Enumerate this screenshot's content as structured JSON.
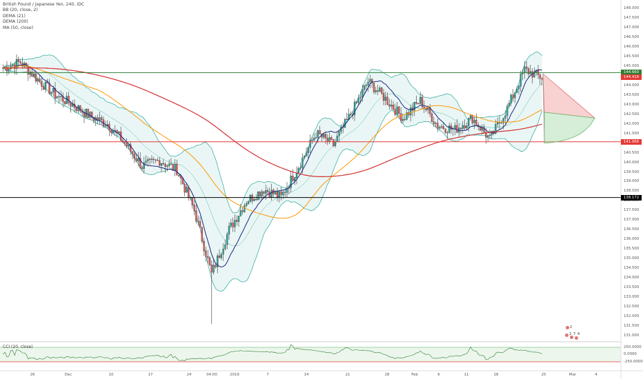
{
  "legend": {
    "title": "British Pound / Japanese Yen, 240, IDC",
    "indicators": [
      "BB (20, close, 2)",
      "DEMA (21)",
      "DEMA (200)",
      "MA (50, close)"
    ]
  },
  "oscillator_label": "CCI (20, close)",
  "price_axis": {
    "ticks": [
      "148.000",
      "147.500",
      "147.000",
      "146.500",
      "146.000",
      "145.500",
      "145.000",
      "144.500",
      "144.000",
      "143.500",
      "143.000",
      "142.500",
      "142.000",
      "141.500",
      "141.000",
      "140.500",
      "140.000",
      "139.500",
      "139.000",
      "138.500",
      "138.000",
      "137.500",
      "137.000",
      "136.500",
      "136.000",
      "135.500",
      "135.000",
      "134.500",
      "134.000",
      "133.500",
      "133.000",
      "132.500",
      "132.000",
      "131.500",
      "131.000"
    ],
    "osc_ticks": [
      "250.0000",
      "0.0000",
      "-250.0000"
    ]
  },
  "price_tags": [
    {
      "label": "144.660",
      "value": 144.66,
      "color": "#2e7d32"
    },
    {
      "label": "144.416",
      "value": 144.416,
      "color": "#e53935"
    },
    {
      "label": "141.066",
      "value": 141.066,
      "color": "#e53935"
    },
    {
      "label": "138.172",
      "value": 138.172,
      "color": "#000000"
    }
  ],
  "time_axis": [
    "26",
    "Dec",
    "10",
    "17",
    "24",
    "04:00",
    "2019",
    "7",
    "14",
    "21",
    "28",
    "Feb",
    "6",
    "11",
    "18",
    "25",
    "Mar",
    "4"
  ],
  "event_flags": {
    "counts": [
      "2",
      "2",
      "7",
      "4"
    ]
  },
  "colors": {
    "bull": "#26a69a",
    "bear": "#ef5350",
    "band": "#b2dfdb",
    "dema21": "#1a237e",
    "dema200": "#d32f2f",
    "ma50": "#ff9800",
    "support": "#e53935",
    "resistance": "#2e7d32",
    "base": "#000000"
  },
  "chart_data": {
    "type": "candlestick",
    "title": "British Pound / Japanese Yen, 240, IDC",
    "xlabel": "",
    "ylabel": "",
    "ylim": [
      131.0,
      148.0
    ],
    "grid": false,
    "horizontal_lines": [
      {
        "value": 144.66,
        "color": "#2e7d32"
      },
      {
        "value": 141.066,
        "color": "#e53935"
      },
      {
        "value": 138.172,
        "color": "#000000"
      }
    ],
    "close_path": [
      {
        "x": "Nov 21",
        "y": 144.9
      },
      {
        "x": "Nov 26",
        "y": 145.2
      },
      {
        "x": "Dec 3",
        "y": 144.3
      },
      {
        "x": "Dec 6",
        "y": 143.5
      },
      {
        "x": "Dec 10",
        "y": 143.0
      },
      {
        "x": "Dec 13",
        "y": 142.4
      },
      {
        "x": "Dec 17",
        "y": 142.0
      },
      {
        "x": "Dec 20",
        "y": 141.0
      },
      {
        "x": "Dec 24",
        "y": 139.8
      },
      {
        "x": "Dec 27",
        "y": 140.1
      },
      {
        "x": "Dec 31",
        "y": 139.6
      },
      {
        "x": "Jan 2",
        "y": 137.5
      },
      {
        "x": "Jan 3",
        "y": 134.2
      },
      {
        "x": "Jan 4",
        "y": 136.5
      },
      {
        "x": "Jan 7",
        "y": 138.0
      },
      {
        "x": "Jan 10",
        "y": 138.6
      },
      {
        "x": "Jan 14",
        "y": 138.2
      },
      {
        "x": "Jan 16",
        "y": 139.8
      },
      {
        "x": "Jan 18",
        "y": 141.5
      },
      {
        "x": "Jan 21",
        "y": 140.9
      },
      {
        "x": "Jan 24",
        "y": 142.5
      },
      {
        "x": "Jan 28",
        "y": 144.2
      },
      {
        "x": "Jan 31",
        "y": 143.3
      },
      {
        "x": "Feb 4",
        "y": 142.3
      },
      {
        "x": "Feb 6",
        "y": 143.2
      },
      {
        "x": "Feb 8",
        "y": 141.9
      },
      {
        "x": "Feb 12",
        "y": 141.7
      },
      {
        "x": "Feb 15",
        "y": 142.3
      },
      {
        "x": "Feb 18",
        "y": 141.2
      },
      {
        "x": "Feb 20",
        "y": 142.8
      },
      {
        "x": "Feb 21",
        "y": 144.8
      },
      {
        "x": "Feb 25",
        "y": 144.4
      }
    ],
    "projection_wedge": {
      "apex": 144.6,
      "upper": 142.3,
      "lower": 141.0
    }
  }
}
